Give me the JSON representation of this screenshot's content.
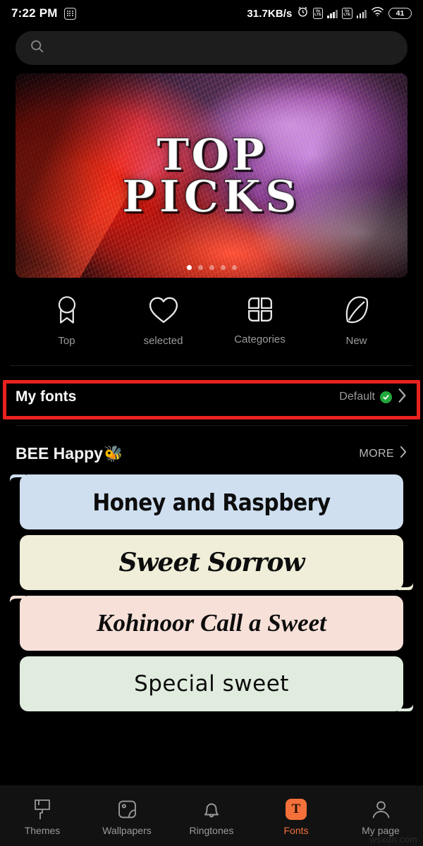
{
  "status_bar": {
    "time": "7:22 PM",
    "left_icon": "app-drawer-icon",
    "network_speed": "31.7KB/s",
    "alarm_icon": "alarm-clock-icon",
    "sim1_volte": "VoLTE",
    "sim2_volte": "VoLTE",
    "wifi_icon": "wifi-icon",
    "battery_level": "41"
  },
  "search": {
    "icon": "search-icon",
    "value": "",
    "placeholder": ""
  },
  "banner": {
    "title_line1": "TOP",
    "title_line2": "PICKS",
    "dots_total": 5,
    "dot_active_index": 0
  },
  "categories": [
    {
      "label": "Top",
      "icon": "ribbon-award-icon"
    },
    {
      "label": "selected",
      "icon": "heart-icon"
    },
    {
      "label": "Categories",
      "icon": "four-petal-grid-icon"
    },
    {
      "label": "New",
      "icon": "leaf-icon"
    }
  ],
  "my_fonts": {
    "title": "My fonts",
    "value": "Default",
    "badge_icon": "green-check-badge-icon",
    "chevron_icon": "chevron-right-icon",
    "highlight_color": "#e8221f"
  },
  "section": {
    "title": "BEE Happy",
    "title_emoji": "🐝",
    "more_label": "MORE",
    "more_icon": "chevron-right-icon"
  },
  "font_cards": [
    {
      "text": "Honey and Raspbery",
      "bg": "#cfdff0",
      "tail": "top-left",
      "style": "f-honey"
    },
    {
      "text": "Sweet Sorrow",
      "bg": "#f0eed8",
      "tail": "bottom-right",
      "style": "f-sorrow"
    },
    {
      "text": "Kohinoor  Call a Sweet",
      "bg": "#f6e0d8",
      "tail": "top-left",
      "style": "f-kohinoor"
    },
    {
      "text": "Special sweet",
      "bg": "#e0edde",
      "tail": "bottom-right",
      "style": "f-special"
    }
  ],
  "bottom_nav": {
    "active_color": "#f4703a",
    "items": [
      {
        "label": "Themes",
        "icon": "paint-roller-icon",
        "active": false
      },
      {
        "label": "Wallpapers",
        "icon": "image-icon",
        "active": false
      },
      {
        "label": "Ringtones",
        "icon": "bell-icon",
        "active": false
      },
      {
        "label": "Fonts",
        "icon": "font-t-icon",
        "active": true
      },
      {
        "label": "My page",
        "icon": "person-icon",
        "active": false
      }
    ]
  },
  "watermark": "wsxdn.com"
}
